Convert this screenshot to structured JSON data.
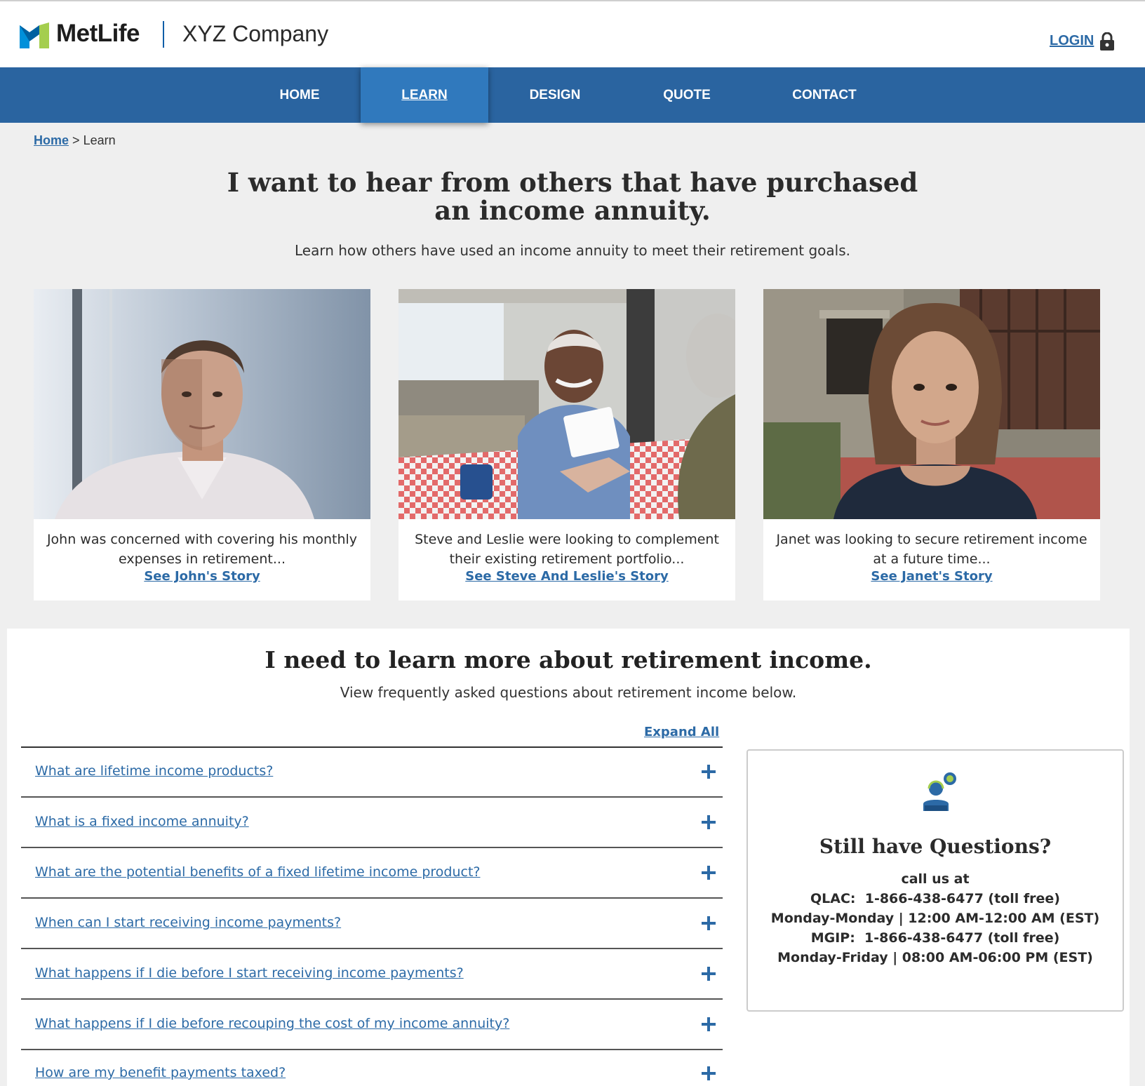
{
  "header": {
    "brand": "MetLife",
    "company": "XYZ Company",
    "login_label": "LOGIN"
  },
  "nav": {
    "items": [
      {
        "label": "HOME"
      },
      {
        "label": "LEARN"
      },
      {
        "label": "DESIGN"
      },
      {
        "label": "QUOTE"
      },
      {
        "label": "CONTACT"
      }
    ],
    "active": "LEARN"
  },
  "breadcrumb": {
    "home": "Home",
    "separator": ">",
    "current": "Learn"
  },
  "stories": {
    "title": "I want to hear from others that have purchased an income annuity.",
    "subtitle": "Learn how others have used an income annuity to meet their retirement goals.",
    "cards": [
      {
        "desc": "John was concerned with covering his monthly expenses in retirement...",
        "link": "See John's Story"
      },
      {
        "desc": "Steve and Leslie were looking to complement their existing retirement portfolio...",
        "link": "See Steve And Leslie's Story"
      },
      {
        "desc": "Janet was looking to secure retirement income at a future time...",
        "link": "See Janet's Story"
      }
    ]
  },
  "faq": {
    "title": "I need to learn more about retirement income.",
    "subtitle": "View frequently asked questions about retirement income below.",
    "expand_all": "Expand All",
    "questions": [
      "What are lifetime income products?",
      "What is a fixed income annuity?",
      "What are the potential benefits of a fixed lifetime income product?",
      "When can I start receiving income payments?",
      "What happens if I die before I start receiving income payments?",
      "What happens if I die before recouping the cost of my income annuity?",
      "How are my benefit payments taxed?"
    ]
  },
  "contact_box": {
    "title": "Still have Questions?",
    "lines": [
      "call us at",
      "QLAC:  1-866-438-6477 (toll free)",
      "Monday-Monday | 12:00 AM-12:00 AM (EST)",
      "MGIP:  1-866-438-6477 (toll free)",
      "Monday-Friday | 08:00 AM-06:00 PM (EST)"
    ]
  },
  "colors": {
    "nav_bg": "#2a64a0",
    "nav_active": "#3079bd",
    "link": "#2c6aa6",
    "page_bg": "#efefef"
  }
}
